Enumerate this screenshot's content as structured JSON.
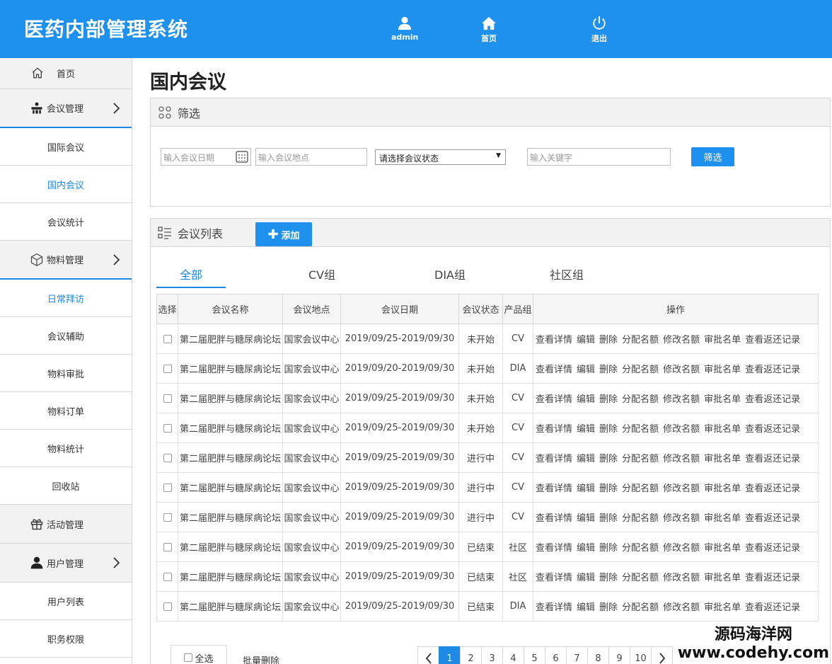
{
  "app": {
    "title": "医药内部管理系统"
  },
  "topnav": {
    "user": "admin",
    "home": "首页",
    "logout": "退出"
  },
  "sidebar": {
    "home": "首页",
    "meeting_group": "会议管理",
    "meeting_items": [
      "国际会议",
      "国内会议",
      "会议统计"
    ],
    "material_group": "物料管理",
    "material_items": [
      "日常拜访",
      "会议辅助",
      "物料审批",
      "物料订单",
      "物料统计",
      "回收站"
    ],
    "activity_group": "活动管理",
    "user_group": "用户管理",
    "user_items": [
      "用户列表",
      "职务权限"
    ]
  },
  "page": {
    "title": "国内会议"
  },
  "filter": {
    "title": "筛选",
    "date_placeholder": "输入会议日期",
    "place_placeholder": "输入会议地点",
    "status_select": "请选择会议状态",
    "keyword_placeholder": "输入关键字",
    "button": "筛选"
  },
  "list": {
    "title": "会议列表",
    "add_button": "添加",
    "tabs": [
      "全部",
      "CV组",
      "DIA组",
      "社区组"
    ],
    "columns": [
      "选择",
      "会议名称",
      "会议地点",
      "会议日期",
      "会议状态",
      "产品组",
      "操作"
    ],
    "ops": [
      "查看详情",
      "编辑",
      "删除",
      "分配名额",
      "修改名额",
      "审批名单",
      "查看返还记录"
    ],
    "rows": [
      {
        "name": "第二届肥胖与糖尿病论坛",
        "place": "国家会议中心",
        "date": "2019/09/25-2019/09/30",
        "status": "未开始",
        "group": "CV"
      },
      {
        "name": "第二届肥胖与糖尿病论坛",
        "place": "国家会议中心",
        "date": "2019/09/20-2019/09/30",
        "status": "未开始",
        "group": "DIA"
      },
      {
        "name": "第二届肥胖与糖尿病论坛",
        "place": "国家会议中心",
        "date": "2019/09/25-2019/09/30",
        "status": "未开始",
        "group": "CV"
      },
      {
        "name": "第二届肥胖与糖尿病论坛",
        "place": "国家会议中心",
        "date": "2019/09/25-2019/09/30",
        "status": "未开始",
        "group": "CV"
      },
      {
        "name": "第二届肥胖与糖尿病论坛",
        "place": "国家会议中心",
        "date": "2019/09/25-2019/09/30",
        "status": "进行中",
        "group": "CV"
      },
      {
        "name": "第二届肥胖与糖尿病论坛",
        "place": "国家会议中心",
        "date": "2019/09/25-2019/09/30",
        "status": "进行中",
        "group": "CV"
      },
      {
        "name": "第二届肥胖与糖尿病论坛",
        "place": "国家会议中心",
        "date": "2019/09/25-2019/09/30",
        "status": "进行中",
        "group": "CV"
      },
      {
        "name": "第二届肥胖与糖尿病论坛",
        "place": "国家会议中心",
        "date": "2019/09/25-2019/09/30",
        "status": "已结束",
        "group": "社区"
      },
      {
        "name": "第二届肥胖与糖尿病论坛",
        "place": "国家会议中心",
        "date": "2019/09/25-2019/09/30",
        "status": "已结束",
        "group": "社区"
      },
      {
        "name": "第二届肥胖与糖尿病论坛",
        "place": "国家会议中心",
        "date": "2019/09/25-2019/09/30",
        "status": "已结束",
        "group": "DIA"
      }
    ],
    "select_all": "全选",
    "batch_delete": "批量删除",
    "pages": [
      "1",
      "2",
      "3",
      "4",
      "5",
      "6",
      "7",
      "8",
      "9",
      "10"
    ]
  },
  "watermark": {
    "line1": "源码海洋网",
    "line2": "www.codehy.com"
  },
  "colors": {
    "primary": "#1e90ee",
    "active_text": "#1e88e5"
  }
}
